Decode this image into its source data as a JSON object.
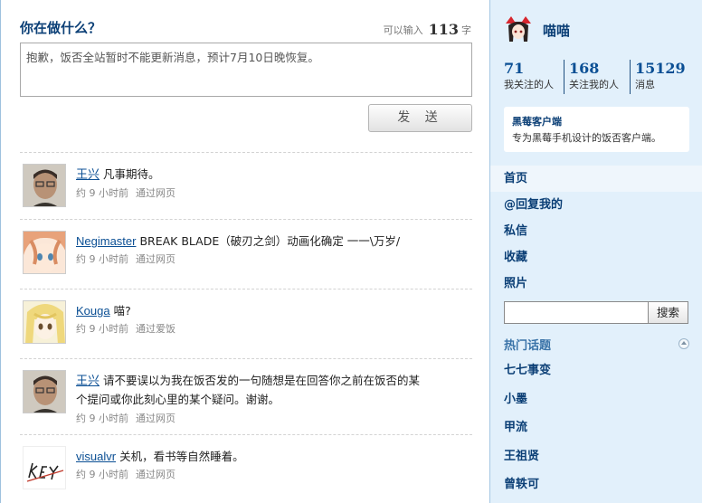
{
  "composer": {
    "prompt": "你在做什么？",
    "counter_prefix": "可以输入",
    "remaining": "113",
    "counter_suffix": "字",
    "status_text": "抱歉，饭否全站暂时不能更新消息，预计7月10日晚恢复。",
    "send_label": "发 送"
  },
  "timeline": [
    {
      "user": "王兴",
      "text": "凡事期待。",
      "time": "约 9 小时前",
      "via": "通过网页",
      "avatar": "avatar-man"
    },
    {
      "user": "Negimaster",
      "text": "BREAK BLADE（破刃之剑）动画化确定 一一\\万岁/",
      "time": "约 9 小时前",
      "via": "通过网页",
      "avatar": "avatar-anime-girl"
    },
    {
      "user": "Kouga",
      "text": "喵?",
      "time": "约 9 小时前",
      "via": "通过爱饭",
      "avatar": "avatar-blonde-girl"
    },
    {
      "user": "王兴",
      "text": "请不要误以为我在饭否发的一句随想是在回答你之前在饭否的某个提问或你此刻心里的某个疑问。谢谢。",
      "time": "约 9 小时前",
      "via": "通过网页",
      "avatar": "avatar-man"
    },
    {
      "user": "visualvr",
      "text": "关机，看书等自然睡着。",
      "time": "约 9 小时前",
      "via": "通过网页",
      "avatar": "avatar-key-logo"
    }
  ],
  "profile": {
    "name": "喵喵",
    "stats": [
      {
        "value": "71",
        "label": "我关注的人"
      },
      {
        "value": "168",
        "label": "关注我的人"
      },
      {
        "value": "15129",
        "label": "消息"
      }
    ]
  },
  "promo": {
    "title": "黑莓客户端",
    "subtitle": "专为黑莓手机设计的饭否客户端。"
  },
  "nav": [
    {
      "label": "首页",
      "active": true
    },
    {
      "label": "@回复我的"
    },
    {
      "label": "私信"
    },
    {
      "label": "收藏"
    },
    {
      "label": "照片"
    }
  ],
  "search": {
    "button_label": "搜索",
    "value": ""
  },
  "topics": {
    "title": "热门话题",
    "items": [
      "七七事变",
      "小墨",
      "甲流",
      "王祖贤",
      "曾轶可"
    ]
  },
  "colors": {
    "link": "#0b4f94",
    "heading": "#0b3f76",
    "sidebar_bg": "#e2f0fb",
    "meta": "#888888"
  }
}
